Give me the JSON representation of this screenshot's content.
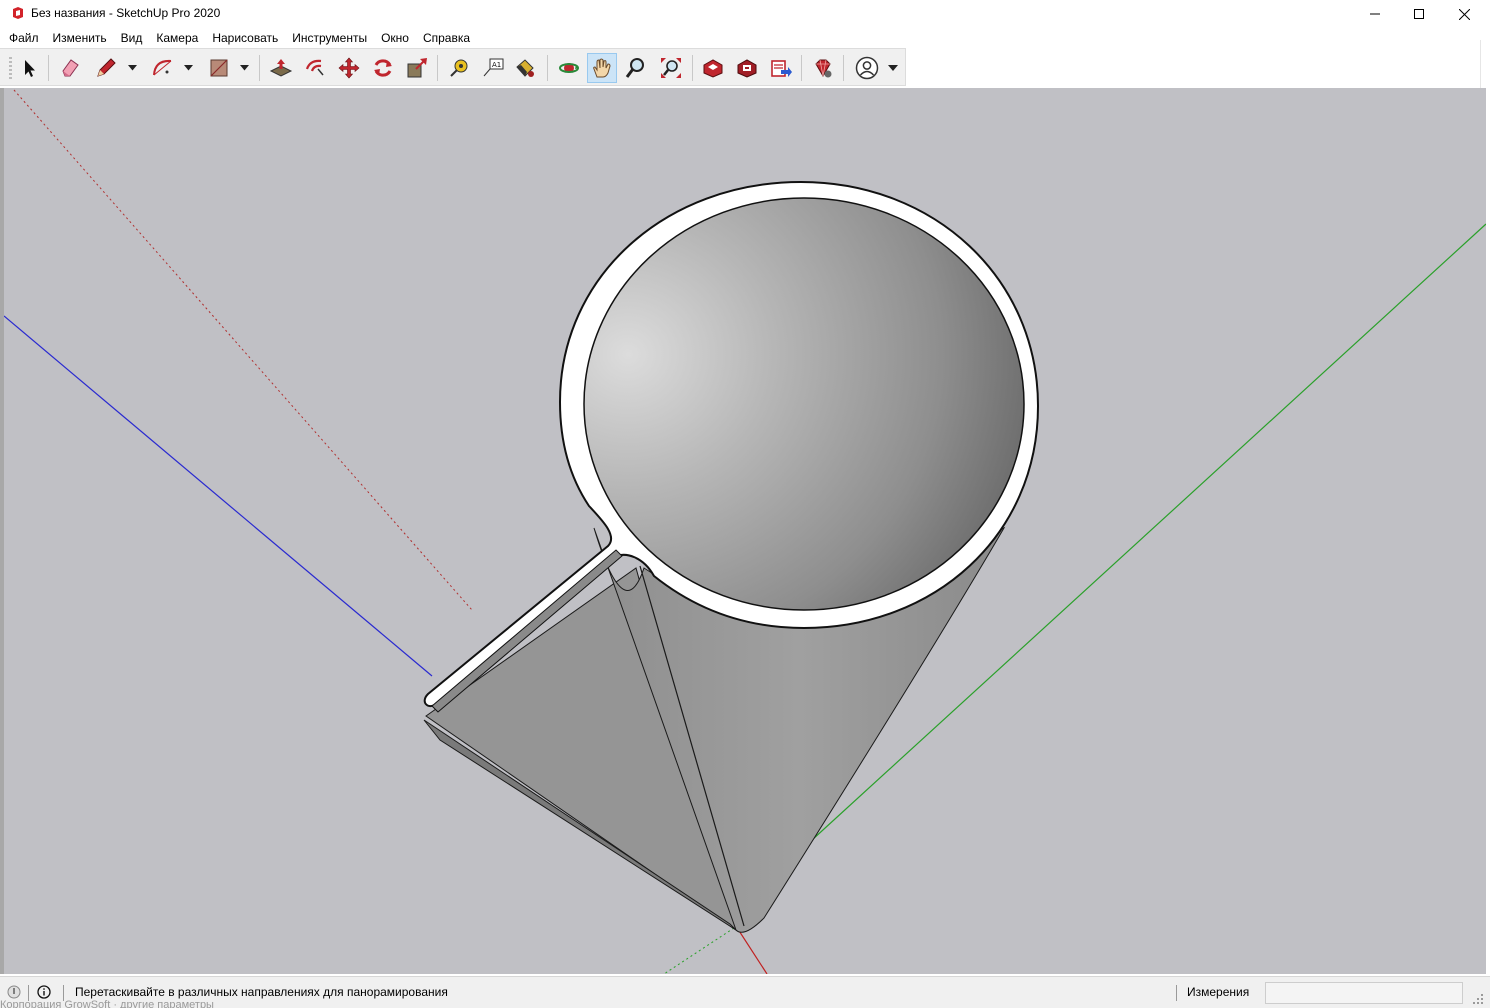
{
  "window": {
    "title": "Без названия - SketchUp Pro 2020",
    "app_icon": "sketchup-logo-icon",
    "controls": [
      "minimize-icon",
      "maximize-icon",
      "close-icon"
    ]
  },
  "menu": {
    "items": [
      "Файл",
      "Изменить",
      "Вид",
      "Камера",
      "Нарисовать",
      "Инструменты",
      "Окно",
      "Справка"
    ]
  },
  "toolbar": {
    "tools": [
      "select-arrow-icon",
      "eraser-icon",
      "pencil-line-icon",
      "arc-icon",
      "rectangle-shape-icon",
      "push-pull-icon",
      "offset-icon",
      "move-icon",
      "rotate-icon",
      "scale-icon",
      "tape-measure-icon",
      "text-label-icon",
      "paint-bucket-icon",
      "orbit-icon",
      "pan-hand-icon",
      "zoom-icon",
      "zoom-extents-icon",
      "3d-warehouse-icon",
      "extension-warehouse-icon",
      "layout-send-icon",
      "extension-manager-icon",
      "account-icon"
    ],
    "active_tool": "pan-hand-icon",
    "text_tool_glyph": "A1"
  },
  "viewport": {
    "background_color": "#c0c0c5",
    "axis_colors": {
      "red": "#b03030",
      "green": "#2aa02a",
      "blue": "#2a2ad0"
    },
    "model": "funnel-with-spout"
  },
  "status": {
    "message": "Перетаскивайте в различных направлениях для панорамирования",
    "measurements_label": "Измерения",
    "measurements_value": "",
    "ghost_text": "Корпорация GrowSoft · другие параметры"
  }
}
